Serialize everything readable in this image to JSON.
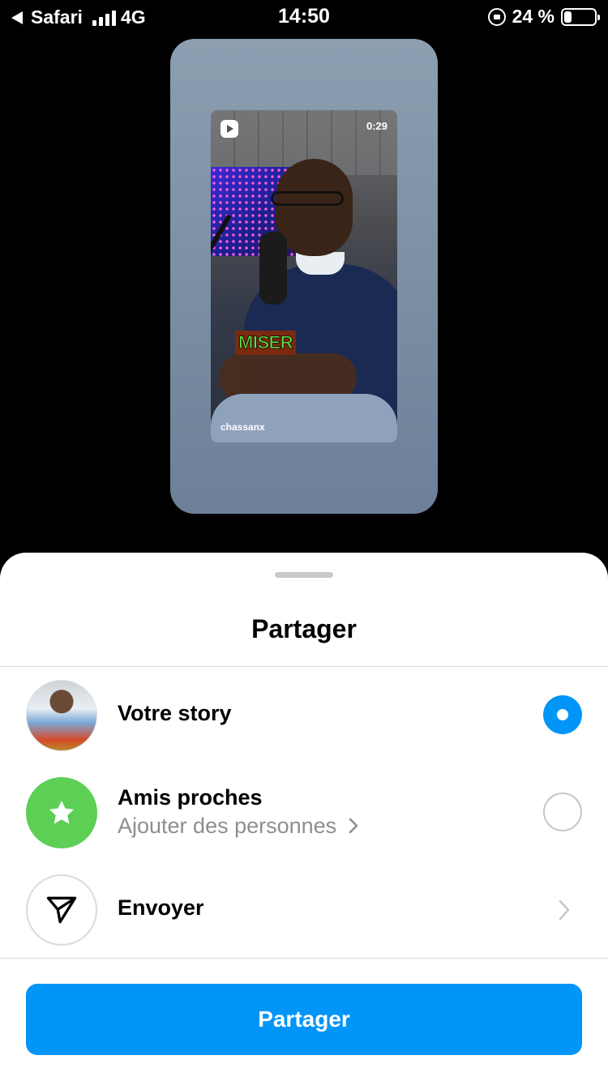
{
  "status_bar": {
    "back_app": "Safari",
    "network": "4G",
    "time": "14:50",
    "battery": "24 %",
    "battery_level": 0.24
  },
  "preview": {
    "duration": "0:29",
    "caption_word": "MISER",
    "username": "chassanx",
    "icons": [
      "reels-icon"
    ]
  },
  "sheet": {
    "title": "Partager",
    "options": [
      {
        "label": "Votre story",
        "selected": true,
        "icon": "profile-avatar"
      },
      {
        "label": "Amis proches",
        "sublabel": "Ajouter des personnes",
        "selected": false,
        "icon": "star-icon"
      },
      {
        "label": "Envoyer",
        "icon": "send-icon"
      }
    ],
    "share_button": "Partager"
  },
  "colors": {
    "accent": "#0095f6",
    "close_friends": "#5ccf54",
    "secondary_text": "#8e8e8e"
  }
}
